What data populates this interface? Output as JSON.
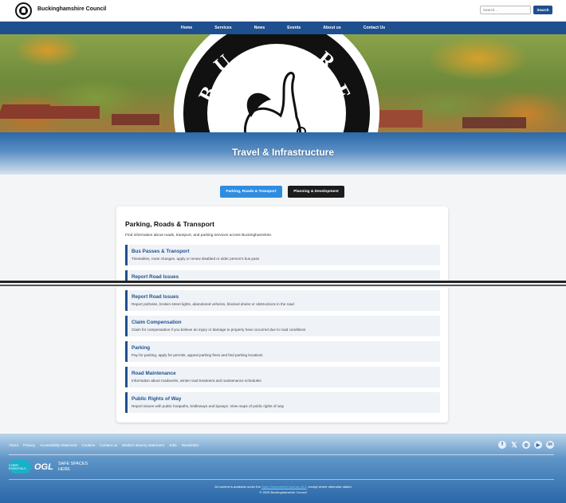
{
  "header": {
    "site_name": "Buckinghamshire Council",
    "search_placeholder": "Search...",
    "search_button": "Search"
  },
  "nav": {
    "items": [
      "Home",
      "Services",
      "News",
      "Events",
      "About us",
      "Contact Us"
    ]
  },
  "hero": {
    "crest_text": "BUCKINGHAMSHIRE COUNCIL"
  },
  "page": {
    "title": "Travel & Infrastructure"
  },
  "tabs": [
    {
      "label": "Parking, Roads & Transport",
      "active": true
    },
    {
      "label": "Planning & Development",
      "active": false
    }
  ],
  "section": {
    "title": "Parking, Roads & Transport",
    "description": "Find information about roads, transport, and parking services across Buckinghamshire.",
    "items_top": [
      {
        "title": "Bus Passes & Transport",
        "desc": "Timetables, route changes, apply or renew disabled or older person's bus pass"
      },
      {
        "title": "Report Road Issues",
        "desc": ""
      }
    ],
    "items": [
      {
        "title": "Report Road Issues",
        "desc": "Report potholes, broken street lights, abandoned vehicles, blocked drains or obstructions in the road"
      },
      {
        "title": "Claim Compensation",
        "desc": "Claim for compensation if you believe an injury or damage to property have occurred due to road conditions"
      },
      {
        "title": "Parking",
        "desc": "Pay for parking, apply for permits, appeal parking fines and find parking locations"
      },
      {
        "title": "Road Maintenance",
        "desc": "Information about roadworks, winter road treatment and maintenance schedules"
      },
      {
        "title": "Public Rights of Way",
        "desc": "Report issues with public footpaths, bridleways and byways. View maps of public rights of way"
      }
    ]
  },
  "footer": {
    "links": [
      "About",
      "Privacy",
      "Accessibility statement",
      "Cookies",
      "Contact us",
      "Modern slavery statement",
      "Jobs",
      "Newsletter"
    ],
    "socials": [
      "facebook-icon",
      "x-icon",
      "instagram-icon",
      "youtube-icon",
      "linkedin-icon"
    ],
    "cyber_badge": "CYBER ESSENTIALS",
    "ogl": "OGL",
    "safe_spaces_1": "SAFE SPACES",
    "safe_spaces_2": "HERE",
    "license_prefix": "All content is available under the",
    "license_link": "Open Government Licence v3.0",
    "license_suffix": ", except where otherwise stated",
    "copyright": "© 2025 Buckinghamshire Council"
  },
  "colors": {
    "brand_blue": "#1e4f8f",
    "tab_active": "#2f8de0",
    "tab_inactive": "#1c1c1c"
  }
}
